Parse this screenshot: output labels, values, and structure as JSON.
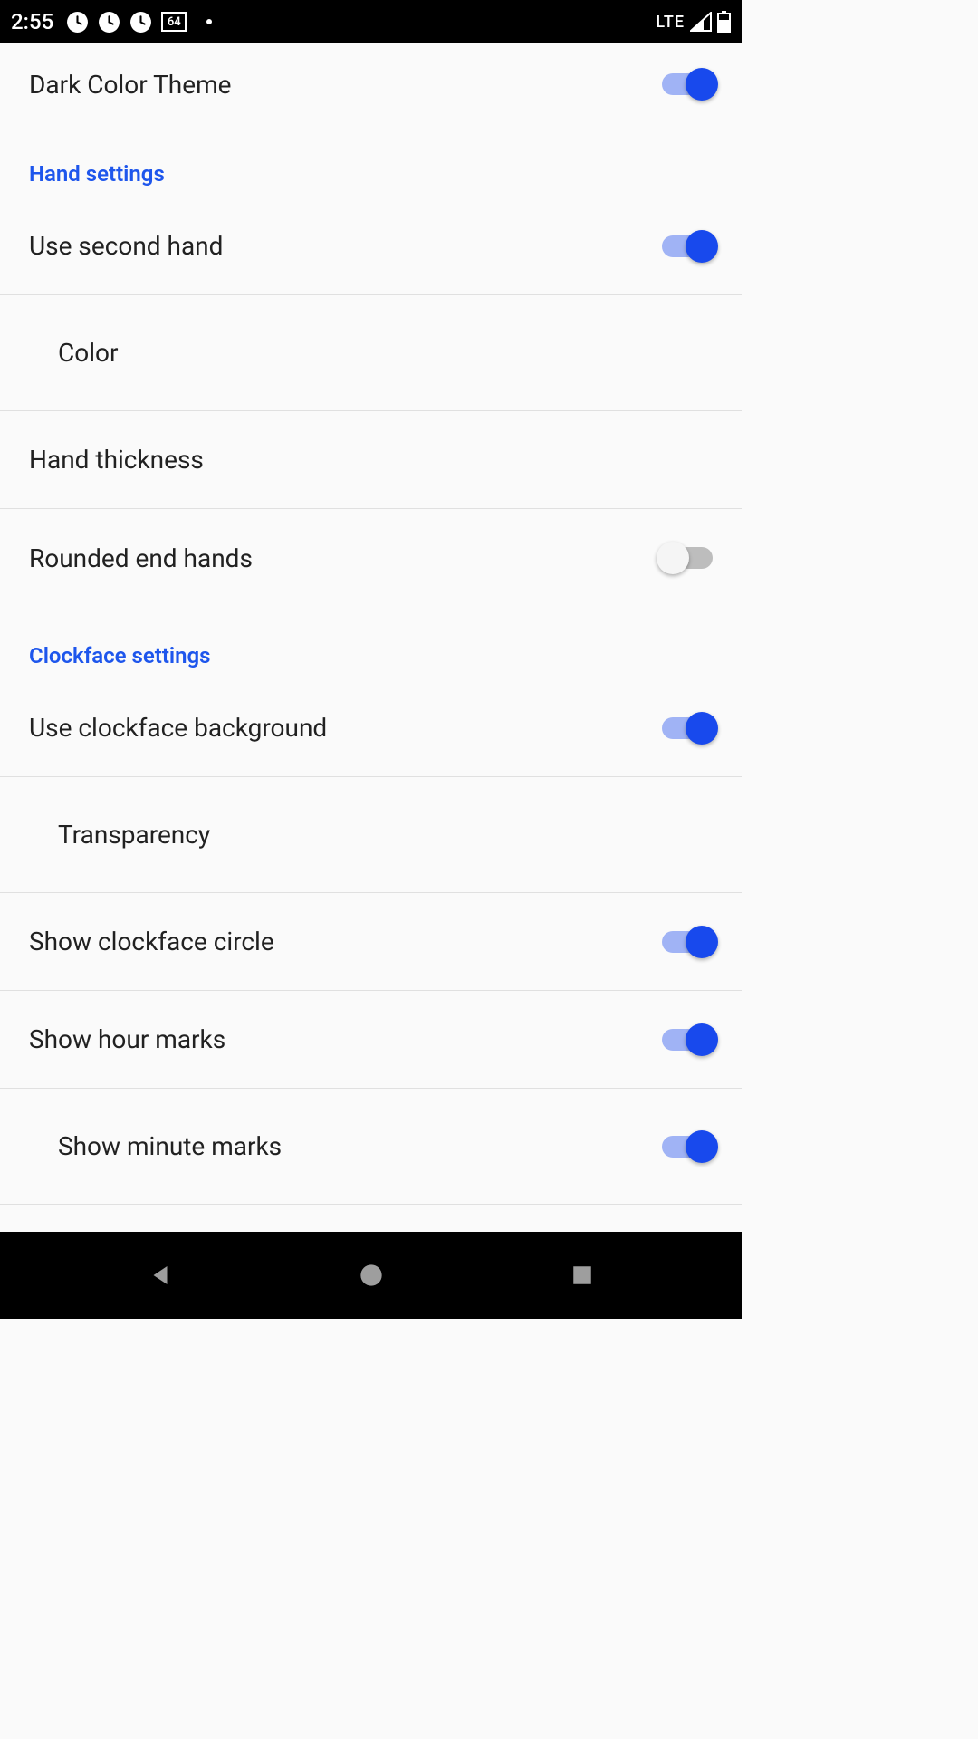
{
  "statusBar": {
    "time": "2:55",
    "batteryBox": "64",
    "network": "LTE"
  },
  "settings": {
    "darkColorTheme": {
      "label": "Dark Color Theme",
      "enabled": true
    },
    "sections": {
      "hand": {
        "title": "Hand settings",
        "items": {
          "useSecondHand": {
            "label": "Use second hand",
            "enabled": true
          },
          "color": {
            "label": "Color"
          },
          "handThickness": {
            "label": "Hand thickness"
          },
          "roundedEndHands": {
            "label": "Rounded end hands",
            "enabled": false
          }
        }
      },
      "clockface": {
        "title": "Clockface settings",
        "items": {
          "useClockfaceBackground": {
            "label": "Use clockface background",
            "enabled": true
          },
          "transparency": {
            "label": "Transparency"
          },
          "showClockfaceCircle": {
            "label": "Show clockface circle",
            "enabled": true
          },
          "showHourMarks": {
            "label": "Show hour marks",
            "enabled": true
          },
          "showMinuteMarks": {
            "label": "Show minute marks",
            "enabled": true
          }
        }
      }
    }
  }
}
